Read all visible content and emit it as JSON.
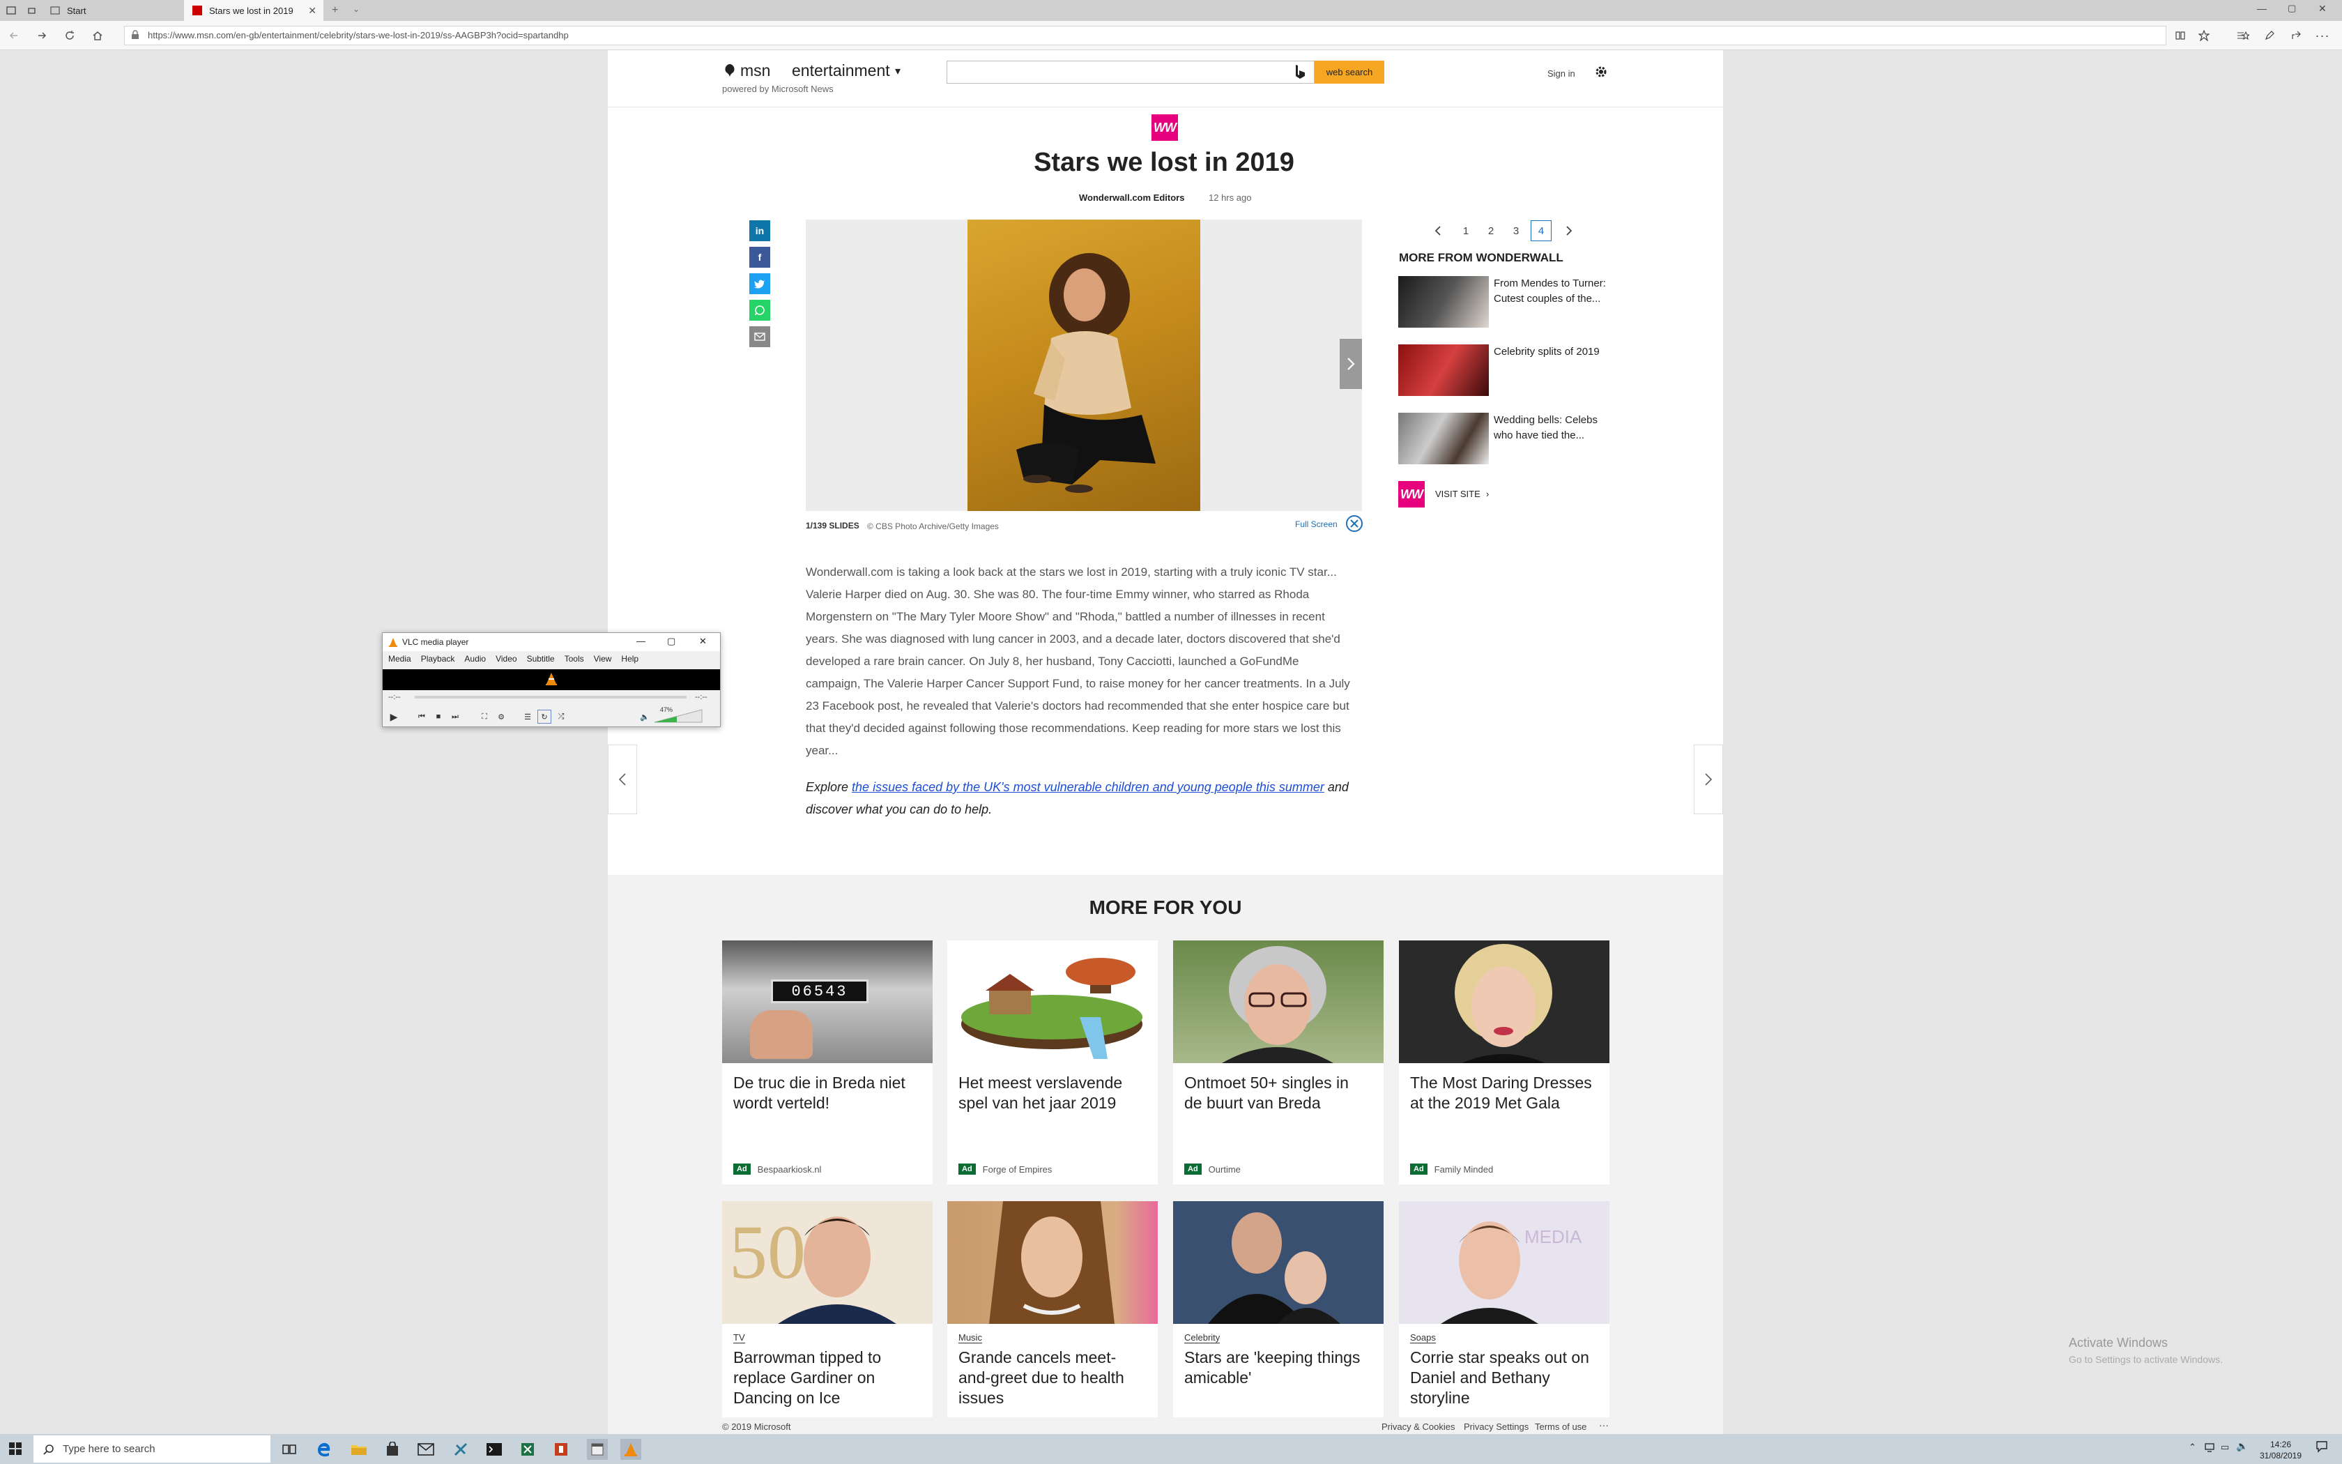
{
  "browser": {
    "tabs": [
      {
        "label": "Start"
      },
      {
        "label": "Stars we lost in 2019"
      }
    ],
    "url": "https://www.msn.com/en-gb/entertainment/celebrity/stars-we-lost-in-2019/ss-AAGBP3h?ocid=spartandhp"
  },
  "header": {
    "brand": "msn",
    "section": "entertainment",
    "powered_by": "powered by Microsoft News",
    "search_button": "web search",
    "sign_in": "Sign in"
  },
  "article": {
    "source_logo": "WW",
    "title": "Stars we lost in 2019",
    "author": "Wonderwall.com Editors",
    "time": "12 hrs ago",
    "slide_counter": "1/139 SLIDES",
    "credit": "© CBS Photo Archive/Getty Images",
    "fullscreen": "Full Screen",
    "body_lines": [
      "Wonderwall.com is taking a look back at the stars we lost in 2019, starting with a truly iconic TV star...",
      "Valerie Harper died on Aug. 30. She was 80. The four-time Emmy winner, who starred as Rhoda",
      "Morgenstern on \"The Mary Tyler Moore Show\" and \"Rhoda,\" battled a number of illnesses in recent",
      "years. She was diagnosed with lung cancer in 2003, and a decade later, doctors discovered that she'd",
      "developed a rare brain cancer. On July 8, her husband, Tony Cacciotti, launched a GoFundMe",
      "campaign, The Valerie Harper Cancer Support Fund, to raise money for her cancer treatments. In a July",
      "23 Facebook post, he revealed that Valerie's doctors had recommended that she enter hospice care but",
      "that they'd decided against following those recommendations. Keep reading for more stars we lost this",
      "year..."
    ],
    "explore_prefix": "Explore ",
    "explore_link": "the issues faced by the UK's most vulnerable children and young people this summer",
    "explore_suffix": " and",
    "explore_line2": "discover what you can do to help."
  },
  "sidebar": {
    "pages": [
      "1",
      "2",
      "3",
      "4"
    ],
    "active_page": "4",
    "heading": "MORE FROM WONDERWALL",
    "items": [
      {
        "line1": "From Mendes to Turner:",
        "line2": "Cutest couples of the..."
      },
      {
        "line1": "Celebrity splits of 2019",
        "line2": ""
      },
      {
        "line1": "Wedding bells: Celebs",
        "line2": "who have tied the..."
      }
    ],
    "visit_site": "VISIT SITE"
  },
  "more_for_you": {
    "heading": "MORE FOR YOU",
    "row1": [
      {
        "title_l1": "De truc die in Breda niet",
        "title_l2": "wordt verteld!",
        "ad": "Ad",
        "source": "Bespaarkiosk.nl"
      },
      {
        "title_l1": "Het meest verslavende",
        "title_l2": "spel van het jaar 2019",
        "ad": "Ad",
        "source": "Forge of Empires"
      },
      {
        "title_l1": "Ontmoet 50+ singles in",
        "title_l2": "de buurt van Breda",
        "ad": "Ad",
        "source": "Ourtime"
      },
      {
        "title_l1": "The Most Daring Dresses",
        "title_l2": "at the 2019 Met Gala",
        "ad": "Ad",
        "source": "Family Minded"
      }
    ],
    "row2": [
      {
        "category": "TV",
        "title_l1": "Barrowman tipped to",
        "title_l2": "replace Gardiner on",
        "title_l3": "Dancing on Ice"
      },
      {
        "category": "Music",
        "title_l1": "Grande cancels meet-",
        "title_l2": "and-greet due to health",
        "title_l3": "issues"
      },
      {
        "category": "Celebrity",
        "title_l1": "Stars are 'keeping things",
        "title_l2": "amicable'",
        "title_l3": ""
      },
      {
        "category": "Soaps",
        "title_l1": "Corrie star speaks out on",
        "title_l2": "Daniel and Bethany",
        "title_l3": "storyline"
      }
    ],
    "meter_digits": "06543"
  },
  "footer": {
    "copyright": "© 2019 Microsoft",
    "links": [
      "Privacy & Cookies",
      "Privacy Settings",
      "Terms of use"
    ],
    "more": "···"
  },
  "watermark": {
    "line1": "Activate Windows",
    "line2": "Go to Settings to activate Windows."
  },
  "vlc": {
    "title": "VLC media player",
    "menu": [
      "Media",
      "Playback",
      "Audio",
      "Video",
      "Subtitle",
      "Tools",
      "View",
      "Help"
    ],
    "time_left": "--:--",
    "time_right": "--:--",
    "volume": "47%"
  },
  "taskbar": {
    "search_placeholder": "Type here to search",
    "time": "14:26",
    "date": "31/08/2019"
  },
  "colors": {
    "accent": "#f5a623",
    "wonderwall": "#e6007e",
    "link": "#1d4ed8",
    "ad_badge": "#0b6d34"
  }
}
